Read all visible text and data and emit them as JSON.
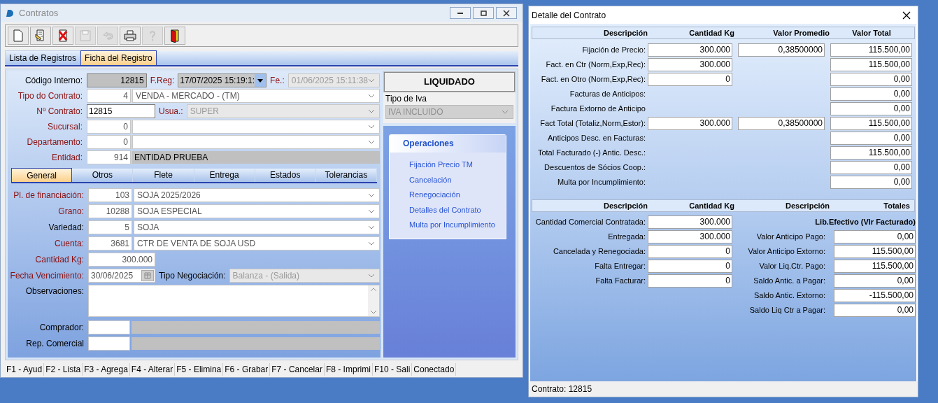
{
  "contratos_window": {
    "title": "Contratos",
    "toolbar": [
      {
        "kind": "new",
        "disabled": false
      },
      {
        "kind": "edit",
        "disabled": false
      },
      {
        "kind": "delete",
        "disabled": false
      },
      {
        "kind": "save",
        "disabled": true
      },
      {
        "kind": "undo",
        "disabled": true
      },
      {
        "kind": "print",
        "disabled": false
      },
      {
        "kind": "help",
        "disabled": true
      },
      {
        "kind": "exit",
        "disabled": false
      }
    ],
    "tabs": [
      {
        "label": "Lista de Registros",
        "selected": false
      },
      {
        "label": "Ficha del Registro",
        "selected": true
      }
    ],
    "form_rows": [
      {
        "label": "Código Interno:",
        "required": false,
        "cells": [
          {
            "kind": "code",
            "text": "12815"
          },
          {
            "kind": "label",
            "text": "F.Reg:",
            "required": true
          },
          {
            "kind": "datetime",
            "text": "17/07/2025 15:19:1:"
          },
          {
            "kind": "label",
            "text": "Fe.:",
            "required": true
          },
          {
            "kind": "combo",
            "text": "01/06/2025 15:11:38",
            "disabled": true
          }
        ]
      },
      {
        "label": "Tipo do Contrato:",
        "required": true,
        "cells": [
          {
            "kind": "number",
            "text": "4"
          },
          {
            "kind": "combo",
            "text": "VENDA - MERCADO - (TM)",
            "disabled": false
          }
        ]
      },
      {
        "label": "Nº Contrato:",
        "required": true,
        "cells": [
          {
            "kind": "input",
            "text": "12815"
          },
          {
            "kind": "label",
            "text": "Usua.:",
            "required": true
          },
          {
            "kind": "combo",
            "text": "SUPER",
            "disabled": true
          }
        ]
      },
      {
        "label": "Sucursal:",
        "required": true,
        "cells": [
          {
            "kind": "number",
            "text": "0"
          },
          {
            "kind": "combo",
            "disabled": false
          }
        ]
      },
      {
        "label": "Departamento:",
        "required": true,
        "cells": [
          {
            "kind": "number",
            "text": "0"
          },
          {
            "kind": "combo",
            "disabled": false
          }
        ]
      },
      {
        "label": "Entidad:",
        "required": true,
        "cells": [
          {
            "kind": "number",
            "text": "914"
          },
          {
            "kind": "display",
            "text": "ENTIDAD PRUEBA"
          }
        ]
      }
    ],
    "subtabs": [
      {
        "label": "General",
        "selected": true
      },
      {
        "label": "Otros",
        "selected": false
      },
      {
        "label": "Flete",
        "selected": false
      },
      {
        "label": "Entrega",
        "selected": false
      },
      {
        "label": "Estados",
        "selected": false
      },
      {
        "label": "Tolerancias",
        "selected": false
      }
    ],
    "general_rows": [
      {
        "label": "Pl. de financiación:",
        "required": true,
        "cells": [
          {
            "kind": "number",
            "text": "103"
          },
          {
            "kind": "combo",
            "text": "SOJA 2025/2026",
            "disabled": false
          }
        ]
      },
      {
        "label": "Grano:",
        "required": true,
        "cells": [
          {
            "kind": "number",
            "text": "10288"
          },
          {
            "kind": "combo",
            "text": "SOJA ESPECIAL",
            "disabled": false
          }
        ]
      },
      {
        "label": "Variedad:",
        "required": false,
        "cells": [
          {
            "kind": "number",
            "text": "5"
          },
          {
            "kind": "combo",
            "text": "SOJA",
            "disabled": false
          }
        ]
      },
      {
        "label": "Cuenta:",
        "required": true,
        "cells": [
          {
            "kind": "number",
            "text": "3681"
          },
          {
            "kind": "combo",
            "text": "CTR DE VENTA DE SOJA USD",
            "disabled": false
          }
        ]
      },
      {
        "label": "Cantidad Kg:",
        "required": true,
        "cells": [
          {
            "kind": "amount",
            "text": "300.000"
          }
        ]
      },
      {
        "label": "Fecha Vencimiento:",
        "required": true,
        "cells": [
          {
            "kind": "date",
            "text": "30/06/2025"
          },
          {
            "kind": "label",
            "text": "Tipo Negociación:",
            "required": false
          },
          {
            "kind": "combo",
            "text": "Balanza - (Salida)",
            "disabled": true
          }
        ]
      },
      {
        "label": "Observaciones:",
        "required": false,
        "cells": [
          {
            "kind": "memo"
          }
        ]
      },
      {
        "label": "Comprador:",
        "required": false,
        "cells": [
          {
            "kind": "blank"
          },
          {
            "kind": "display"
          }
        ]
      },
      {
        "label": "Rep. Comercial",
        "required": false,
        "cells": [
          {
            "kind": "blank"
          },
          {
            "kind": "display"
          }
        ]
      }
    ],
    "status": "LIQUIDADO",
    "iva": {
      "label": "Tipo de Iva",
      "value": "IVA INCLUIDO",
      "disabled": true
    },
    "operaciones": {
      "title": "Operaciones",
      "links": [
        "Fijación Precio TM",
        "Cancelación",
        "Renegociación",
        "Detalles del Contrato",
        "Multa por Incumplimiento"
      ]
    },
    "status_bar": [
      "F1 - Ayud",
      "F2 - Lista",
      "F3 - Agrega",
      "F4 - Alterar",
      "F5 - Elimina",
      "F6 - Grabar",
      "F7 - Cancelar",
      "F8 - Imprimi",
      "F10 - Sali",
      "Conectado"
    ]
  },
  "detalle_window": {
    "title": "Detalle del Contrato",
    "price_table": {
      "columns": [
        "Descripción",
        "Cantidad Kg",
        "Valor Promedio",
        "Valor Total"
      ],
      "rows": [
        {
          "label": "Fijación de Precio:",
          "cantidad": "300.000",
          "promedio": "0,38500000",
          "total": "115.500,00"
        },
        {
          "label": "Fact. en Ctr (Norm,Exp,Rec):",
          "cantidad": "300.000",
          "total": "115.500,00"
        },
        {
          "label": "Fact. en Otro (Norm,Exp,Rec):",
          "cantidad": "0",
          "total": "0,00"
        },
        {
          "label": "Facturas de Anticipos:",
          "total": "0,00"
        },
        {
          "label": "Factura Extorno de Anticipo",
          "total": "0,00"
        },
        {
          "label": "Fact Total (Totaliz,Norm,Estor):",
          "cantidad": "300.000",
          "promedio": "0,38500000",
          "total": "115.500,00"
        },
        {
          "label": "Anticipos Desc. en Facturas:",
          "total": "0,00"
        },
        {
          "label": "Total Facturado (-) Antic. Desc.:",
          "total": "115.500,00"
        },
        {
          "label": "Descuentos de Sócios Coop.:",
          "total": "0,00"
        },
        {
          "label": "Multa por Incumplimiento:",
          "total": "0,00"
        }
      ]
    },
    "balance_table": {
      "columns": [
        "Descripción",
        "Cantidad Kg",
        "Descripción",
        "Totales"
      ],
      "left_rows": [
        {
          "label": "Cantidad Comercial Contratada:",
          "value": "300.000"
        },
        {
          "label": "Entregada:",
          "value": "300.000"
        },
        {
          "label": "Cancelada y Renegociada:",
          "value": "0"
        },
        {
          "label": "Falta Entregar:",
          "value": "0"
        },
        {
          "label": "Falta Facturar:",
          "value": "0"
        }
      ],
      "right_title": "Lib.Efectivo (Vlr Facturado)",
      "right_rows": [
        {
          "label": "Valor Anticipo Pago:",
          "value": "0,00"
        },
        {
          "label": "Valor Anticipo Extorno:",
          "value": "115.500,00"
        },
        {
          "label": "Valor Liq.Ctr. Pago:",
          "value": "115.500,00"
        },
        {
          "label": "Saldo Antic. a Pagar:",
          "value": "0,00"
        },
        {
          "label": "Saldo Antic. Extorno:",
          "value": "-115.500,00"
        },
        {
          "label": "Saldo Liq Ctr a Pagar:",
          "value": "0,00"
        }
      ]
    },
    "status": "Contrato: 12815"
  }
}
